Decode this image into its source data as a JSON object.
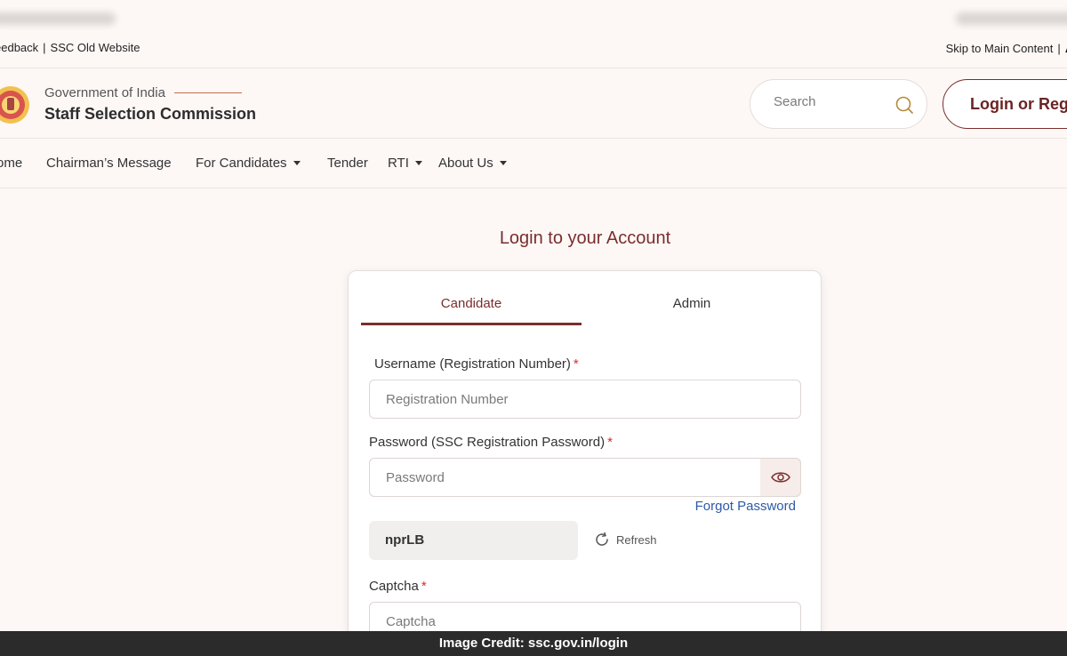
{
  "utility": {
    "feedback": "eedback",
    "old_site": "SSC Old Website",
    "skip": "Skip to Main Content",
    "font_glyph": "A"
  },
  "header": {
    "gov": "Government of India",
    "org": "Staff Selection Commission",
    "search_placeholder": "Search",
    "login_label": "Login or Regi"
  },
  "nav": {
    "home": "ome",
    "chairman": "Chairman’s Message",
    "candidates": "For Candidates",
    "tender": "Tender",
    "rti": "RTI",
    "about": "About Us"
  },
  "login": {
    "title": "Login to your Account",
    "tabs": [
      "Candidate",
      "Admin"
    ],
    "username_label": "Username (Registration Number)",
    "username_placeholder": "Registration Number",
    "password_label": "Password (SSC Registration Password)",
    "password_placeholder": "Password",
    "required_mark": "*",
    "forgot": "Forgot Password",
    "captcha_code": "nprLB",
    "refresh": "Refresh",
    "captcha_label": "Captcha",
    "captcha_placeholder": "Captcha"
  },
  "credit": "Image Credit: ssc.gov.in/login",
  "colors": {
    "accent": "#7a2d2d",
    "link": "#2c5aa8",
    "required": "#d32f2f",
    "background": "#fdf8f6"
  }
}
